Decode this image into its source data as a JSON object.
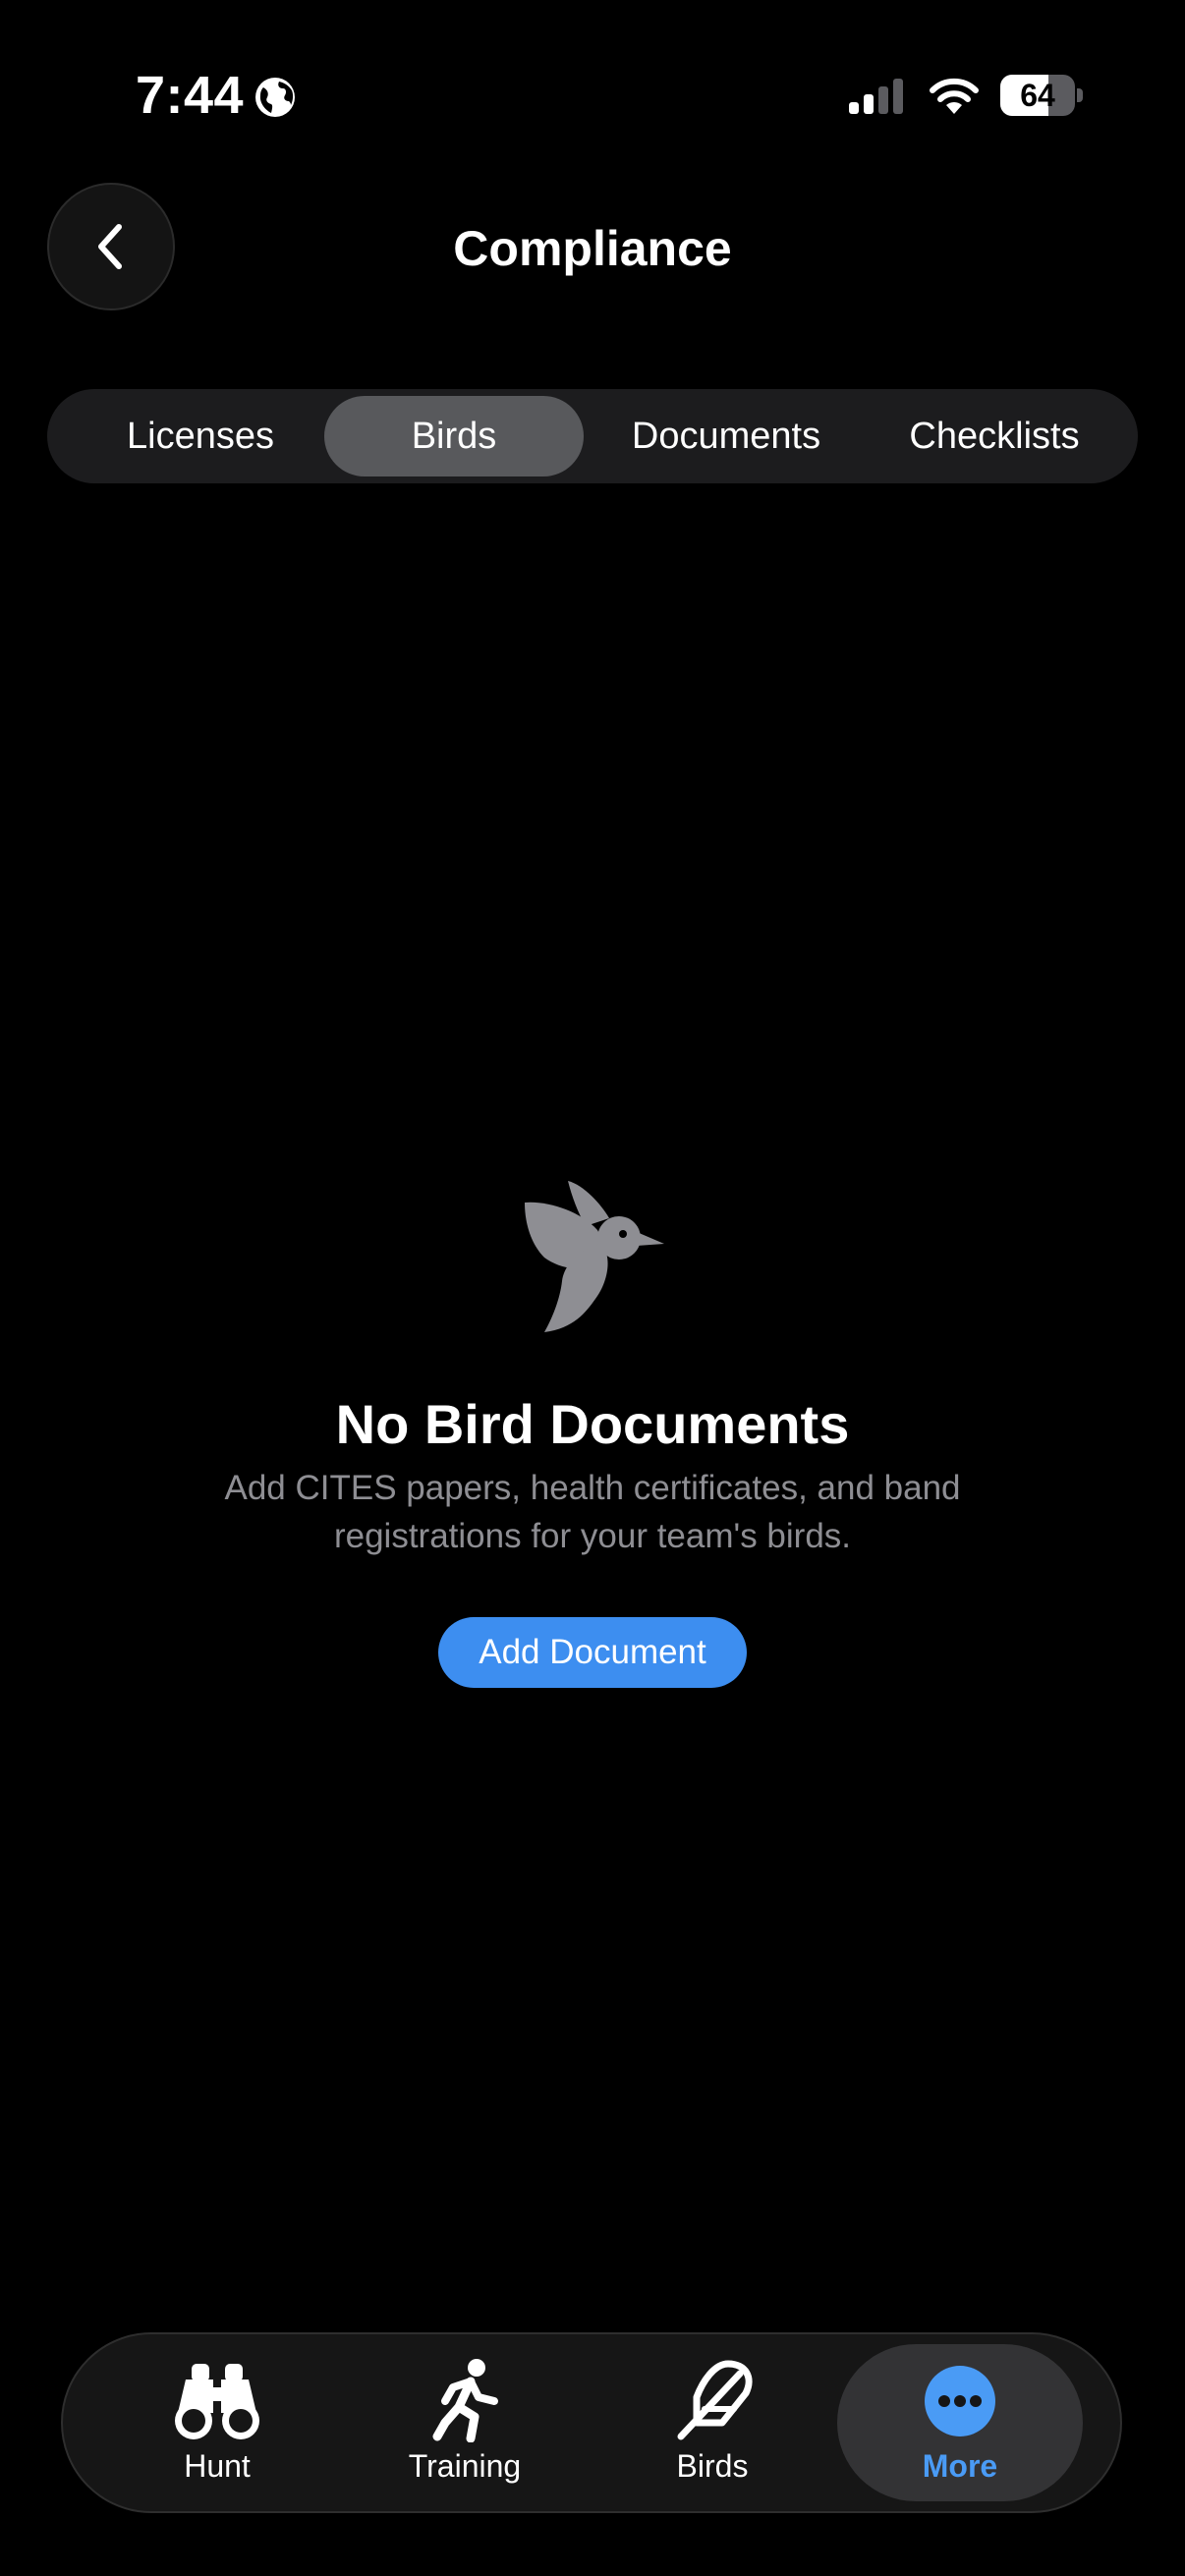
{
  "status_bar": {
    "time": "7:44",
    "battery_level": "64",
    "battery_fraction": 0.64
  },
  "header": {
    "title": "Compliance",
    "back_icon": "chevron-left-icon"
  },
  "segments": [
    {
      "label": "Licenses",
      "active": false
    },
    {
      "label": "Birds",
      "active": true
    },
    {
      "label": "Documents",
      "active": false
    },
    {
      "label": "Checklists",
      "active": false
    }
  ],
  "empty_state": {
    "icon": "bird-icon",
    "title": "No Bird Documents",
    "description": "Add CITES papers, health certificates, and band registrations for your team's birds.",
    "button_label": "Add Document"
  },
  "tab_bar": {
    "items": [
      {
        "label": "Hunt",
        "icon": "binoculars-icon",
        "active": false
      },
      {
        "label": "Training",
        "icon": "running-figure-icon",
        "active": false
      },
      {
        "label": "Birds",
        "icon": "feather-icon",
        "active": false
      },
      {
        "label": "More",
        "icon": "more-icon",
        "active": true
      }
    ]
  },
  "colors": {
    "background": "#000000",
    "accent": "#3d8ef0",
    "active_tab_label": "#4a9bf5",
    "secondary_text": "#8e8e93",
    "segment_active": "#58595c"
  }
}
